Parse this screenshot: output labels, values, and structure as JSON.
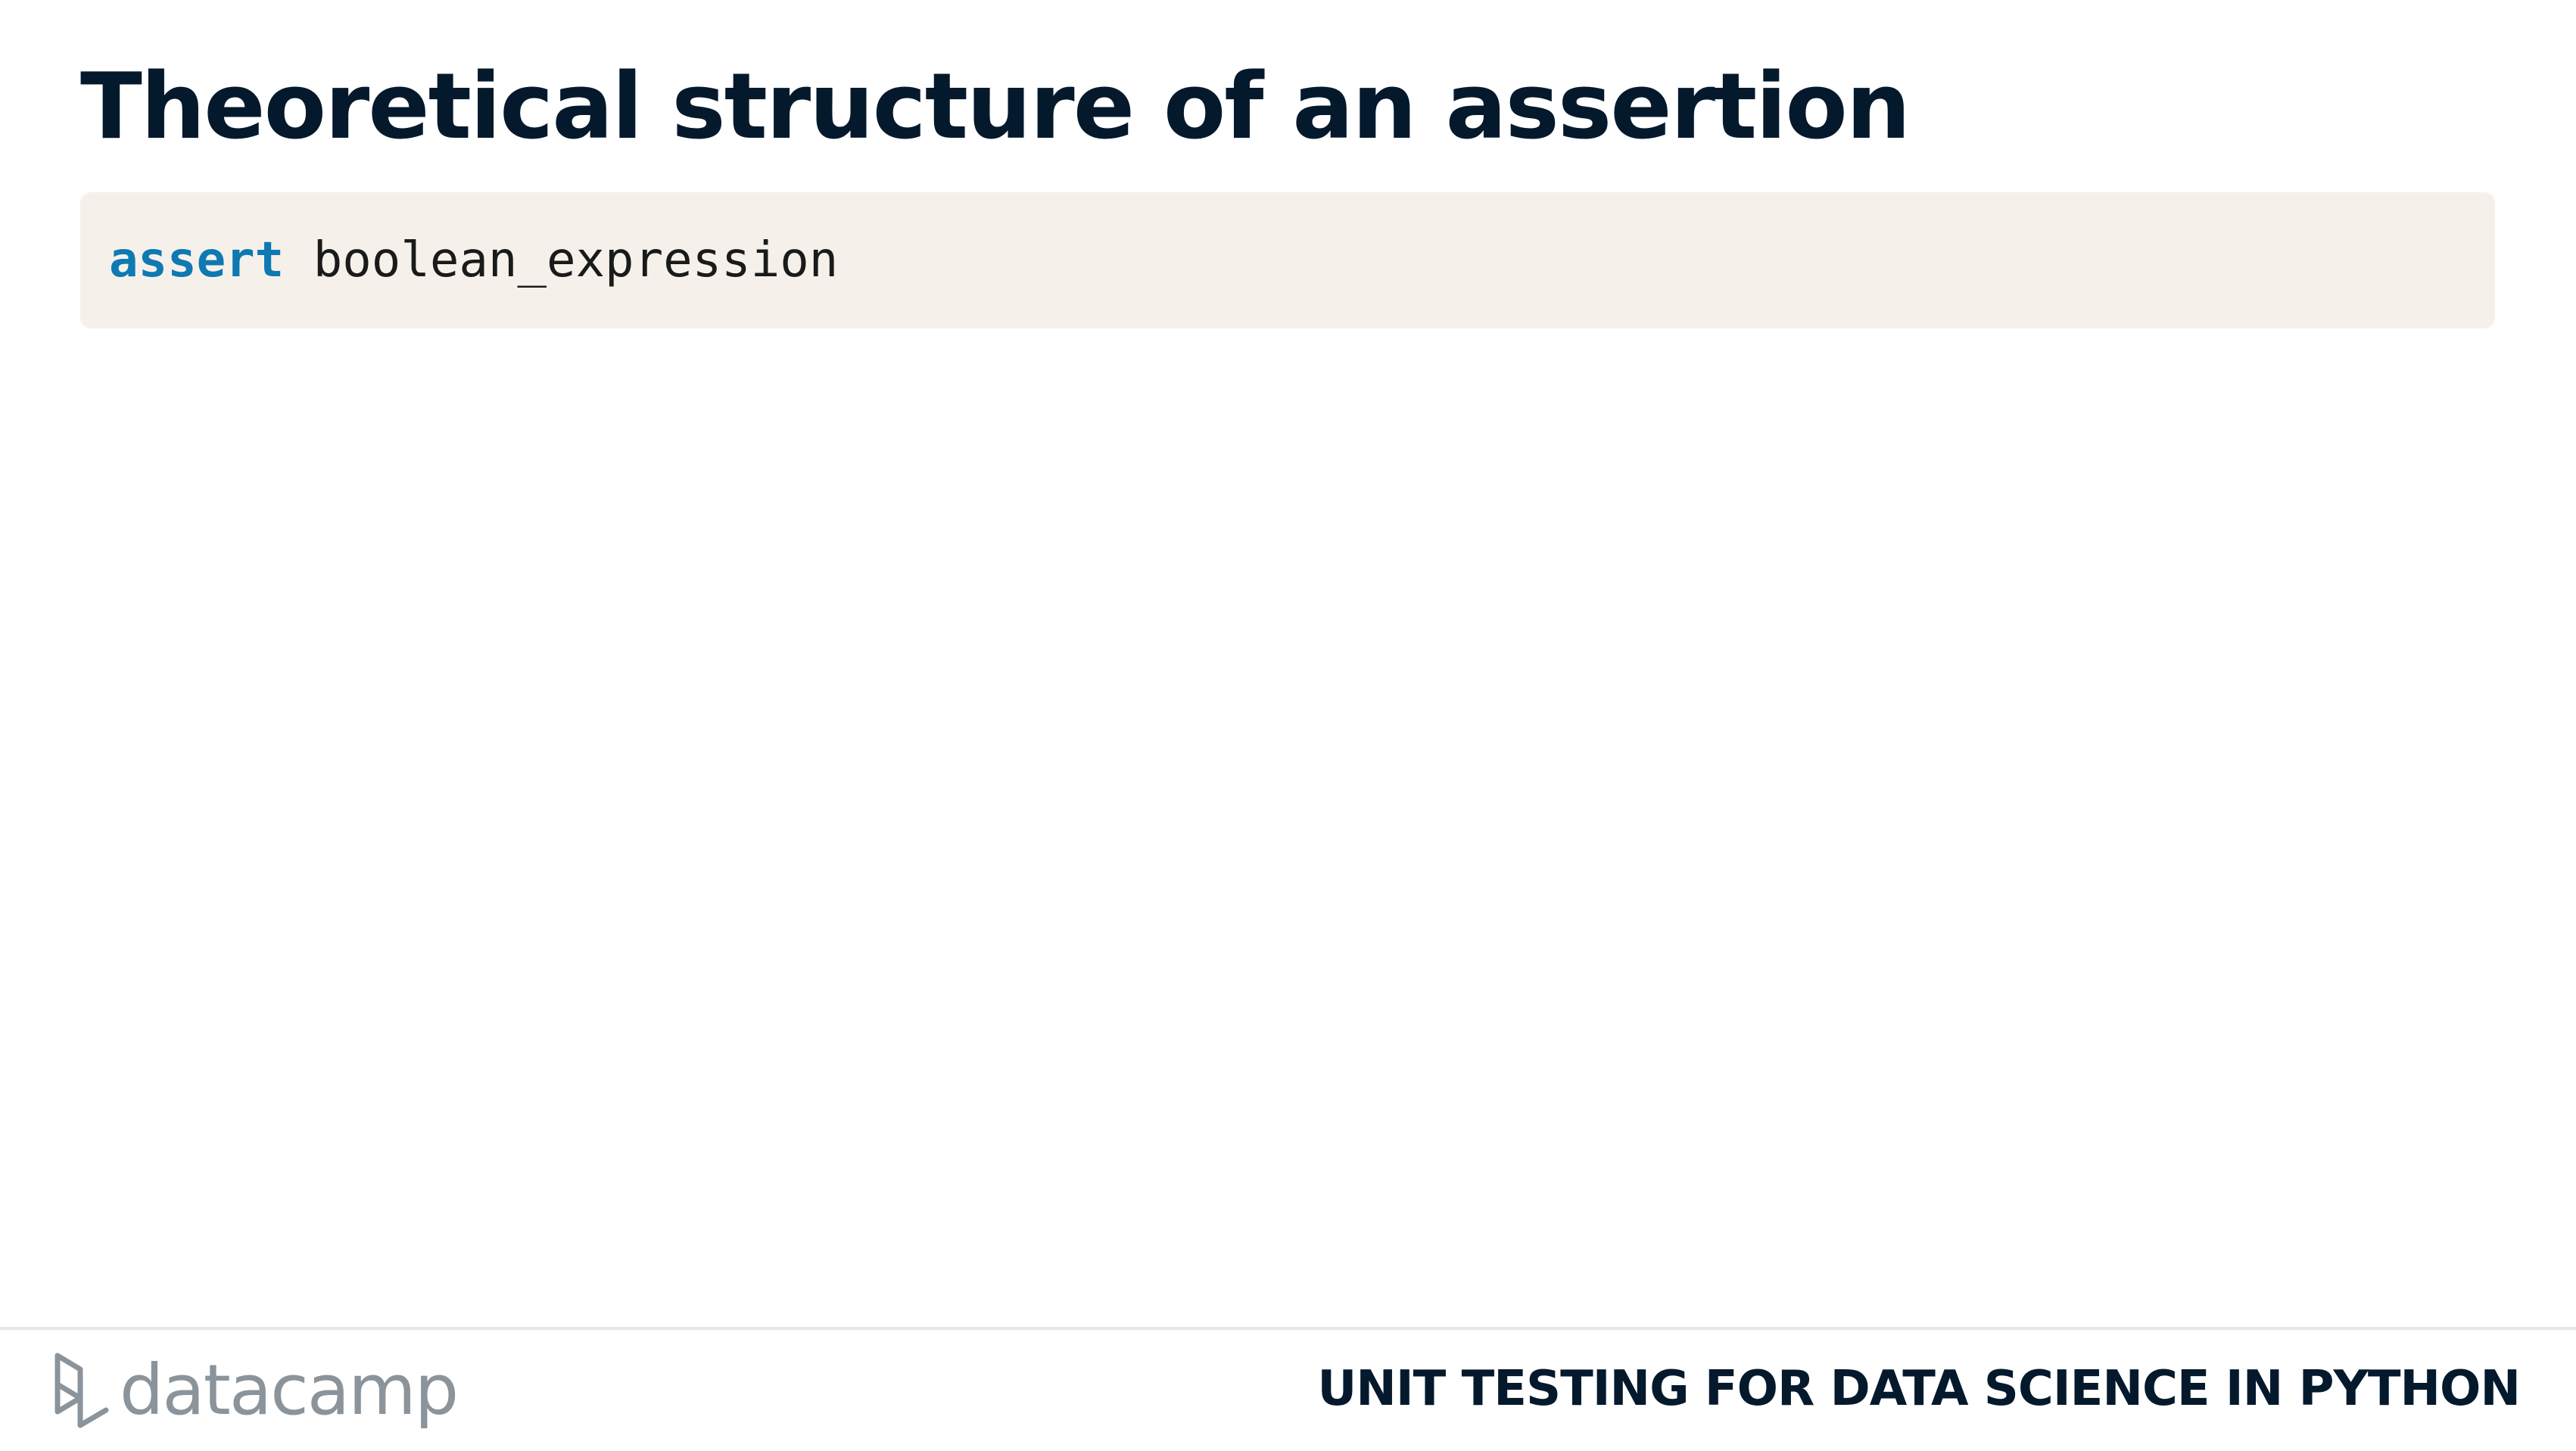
{
  "slide": {
    "title": "Theoretical structure of an assertion"
  },
  "code": {
    "keyword": "assert",
    "expression": " boolean_expression"
  },
  "footer": {
    "brand": "datacamp",
    "course": "UNIT TESTING FOR DATA SCIENCE IN PYTHON"
  },
  "colors": {
    "title": "#05192d",
    "code_background": "#f5f1ea",
    "code_keyword": "#0e79b2",
    "brand_gray": "#8b949b"
  },
  "icons": {
    "logo": "datacamp-logo-icon"
  }
}
